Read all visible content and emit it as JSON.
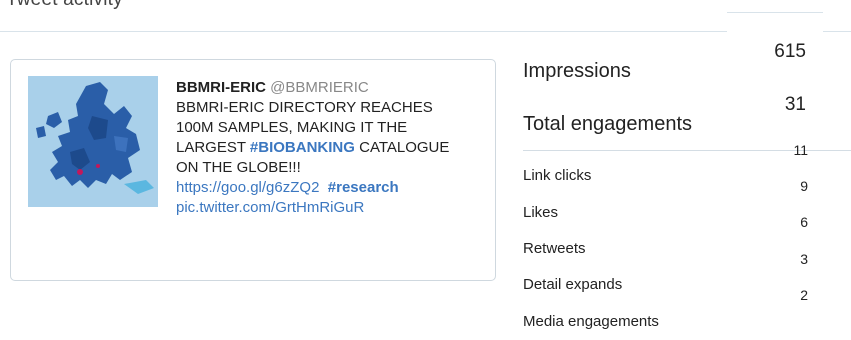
{
  "header": {
    "title": "Tweet activity"
  },
  "tweet": {
    "author_name": "BBMRI-ERIC",
    "author_handle": "@BBMRIERIC",
    "text_part1": "BBMRI-ERIC DIRECTORY REACHES 100M SAMPLES, MAKING IT THE LARGEST ",
    "hashtag": "#BIOBANKING",
    "text_part2": " CATALOGUE ON THE GLOBE!!!",
    "link_url": "https://goo.gl/g6zZQ2",
    "link_hashtag": "#research",
    "pic_url": "pic.twitter.com/GrtHmRiGuR"
  },
  "metrics": {
    "impressions": {
      "label": "Impressions",
      "value": "615"
    },
    "total_engagements": {
      "label": "Total engagements",
      "value": "31"
    },
    "breakdown": [
      {
        "label": "Link clicks",
        "value": "11"
      },
      {
        "label": "Likes",
        "value": "9"
      },
      {
        "label": "Retweets",
        "value": "6"
      },
      {
        "label": "Detail expands",
        "value": "3"
      },
      {
        "label": "Media engagements",
        "value": "2"
      }
    ]
  },
  "colors": {
    "link": "#3b77c0",
    "divider": "#d4dde4",
    "map_sea": "#9ec8e5",
    "map_land": "#2a5ea8"
  }
}
